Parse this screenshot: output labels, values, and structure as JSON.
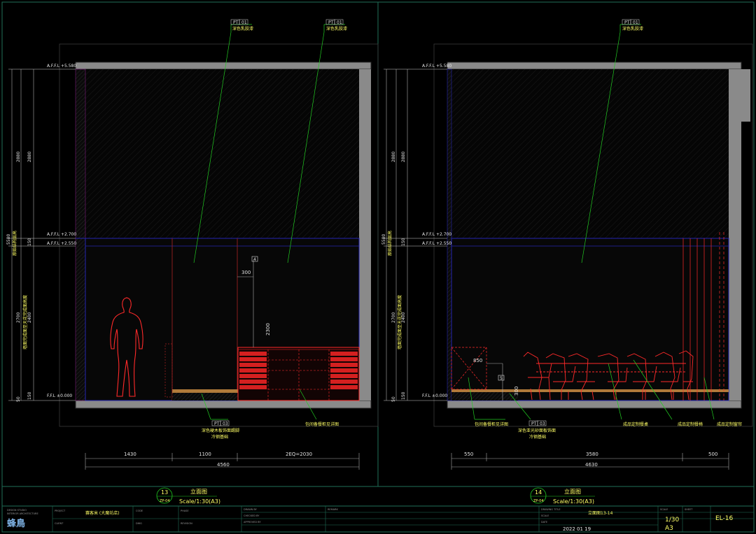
{
  "elevation13": {
    "level_marks": [
      "A.F.F.L +5.580",
      "A.F.F.L +2.700",
      "A.F.F.L +2.550",
      "F.F.L ±0.000"
    ],
    "vertical_dims": [
      "2880",
      "2880",
      "150",
      "2700",
      "2400",
      "50",
      "150",
      "5580"
    ],
    "vertical_notes": [
      "原始结构层高",
      "墙面完成面至天花完成面高度"
    ],
    "dim_300": "300",
    "dim_2300": "2300",
    "tag_box": "4",
    "callout_top_left": {
      "code": "PT",
      "num": "01",
      "text": "深色乳胶漆"
    },
    "callout_top_right": {
      "code": "PT",
      "num": "01",
      "text": "深色乳胶漆"
    },
    "callout_bottom_left": {
      "code": "PT",
      "num": "03",
      "line1": "深色硬木板饰面踢脚",
      "line2": "冷钢基础"
    },
    "callout_bottom_right": "包间备餐柜见详图",
    "bottom_dims": [
      "1430",
      "1100",
      "2EQ=2030"
    ],
    "total_dim": "4560",
    "title_number": "13",
    "title_sheet": "ZP-04",
    "title_name": "立面图",
    "title_scale": "Scale/1:30(A3)"
  },
  "elevation14": {
    "level_marks": [
      "A.F.F.L +5.580",
      "A.F.F.L +2.700",
      "A.F.F.L +2.550",
      "F.F.L ±0.000"
    ],
    "vertical_dims": [
      "2880",
      "2880",
      "150",
      "2700",
      "2400",
      "50",
      "150",
      "5580"
    ],
    "vertical_notes": [
      "原始结构层高",
      "墙面完成面至天花完成面高度"
    ],
    "dim_850": "850",
    "dim_300": "300",
    "tag_box": "5",
    "callout_top": {
      "code": "PT",
      "num": "01",
      "text": "深色乳胶漆"
    },
    "callout_bottom_1": "包间备餐柜见详图",
    "callout_bottom_2": {
      "code": "PT",
      "num": "03",
      "line1": "深色亚光砂面板饰面",
      "line2": "冷钢基础"
    },
    "callout_bottom_3": "成品定制餐桌",
    "callout_bottom_4": "成品定制餐椅",
    "callout_bottom_5": "成品定制窗帘",
    "bottom_dims": [
      "550",
      "3580",
      "500"
    ],
    "total_dim": "4630",
    "title_number": "14",
    "title_sheet": "ZP-04",
    "title_name": "立面图",
    "title_scale": "Scale/1:30(A3)"
  },
  "title_block": {
    "logo": "蜂鳥",
    "project_name": "赛客米 (大魔坊店)",
    "drawing_name": "立面图13-14",
    "date": "2022  01  19",
    "scale": "1/30",
    "paper": "A3",
    "sheet_no": "EL-16"
  },
  "colors": {
    "frame": "#2a8a66",
    "wall": "#808080",
    "outline": "#2424b0",
    "callout": "#22cc22",
    "furniture": "#ff2a2a",
    "text_yellow": "#ffff66"
  }
}
